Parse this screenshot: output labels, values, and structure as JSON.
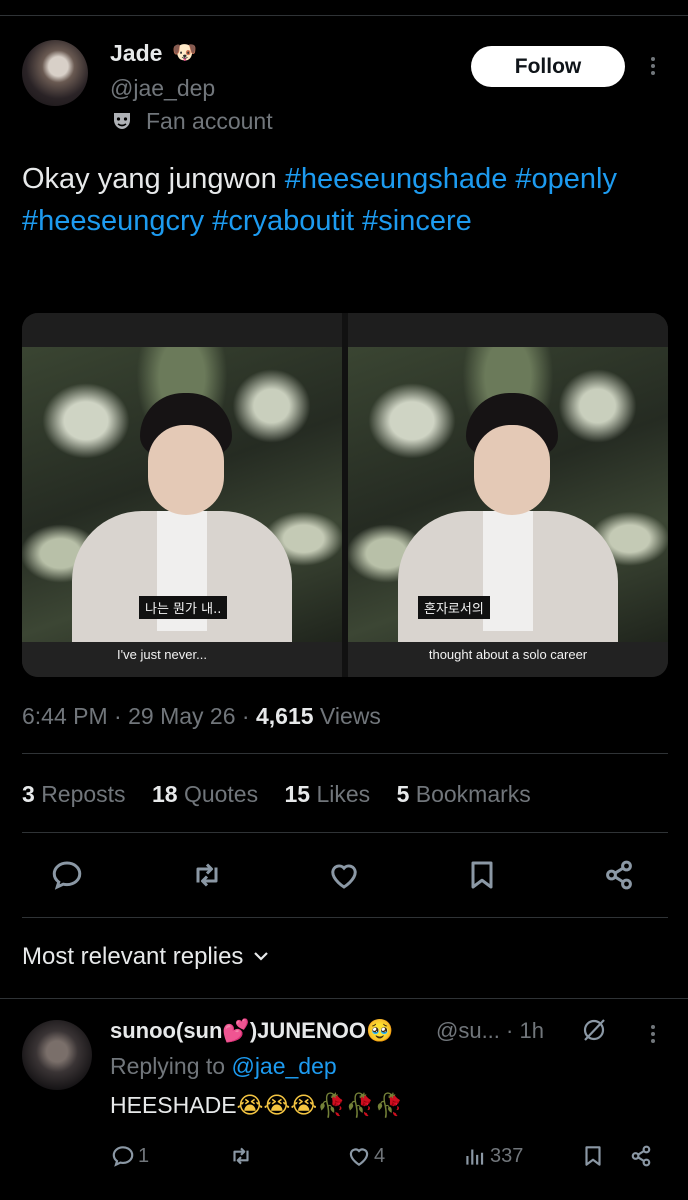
{
  "author": {
    "name": "Jade",
    "name_emoji": "dog-face",
    "handle": "@jae_dep",
    "label": "Fan account",
    "label_icon": "theater-mask-icon"
  },
  "follow_label": "Follow",
  "post": {
    "text": "Okay yang jungwon",
    "hashtags": [
      "#heeseungshade",
      "#openly",
      "#heeseungcry",
      "#cryaboutit",
      "#sincere"
    ]
  },
  "media": [
    {
      "korean_caption": "나는 뭔가 내..",
      "subtitle": "I've just never..."
    },
    {
      "korean_caption": "혼자로서의",
      "subtitle": "thought about a solo career"
    }
  ],
  "meta": {
    "time": "6:44 PM",
    "date": "29 May 26",
    "views_count": "4,615",
    "views_label": "Views"
  },
  "stats": [
    {
      "count": "3",
      "label": "Reposts"
    },
    {
      "count": "18",
      "label": "Quotes"
    },
    {
      "count": "15",
      "label": "Likes"
    },
    {
      "count": "5",
      "label": "Bookmarks"
    }
  ],
  "replies_sort_label": "Most relevant replies",
  "reply": {
    "name": "sunoo(sun💕)JUNENOO🥹",
    "handle": "@su...",
    "time": "· 1h",
    "replying_prefix": "Replying to",
    "replying_to": "@jae_dep",
    "text": "HEESHADE",
    "text_emojis": "😭😭😭",
    "text_roses": "🥀🥀🥀",
    "reply_count": "1",
    "like_count": "4",
    "view_count": "337"
  },
  "colors": {
    "background": "#000000",
    "text": "#e7e9ea",
    "muted": "#71767b",
    "link": "#1d9bf0",
    "divider": "#2f3336",
    "follow_bg": "#ffffff"
  }
}
